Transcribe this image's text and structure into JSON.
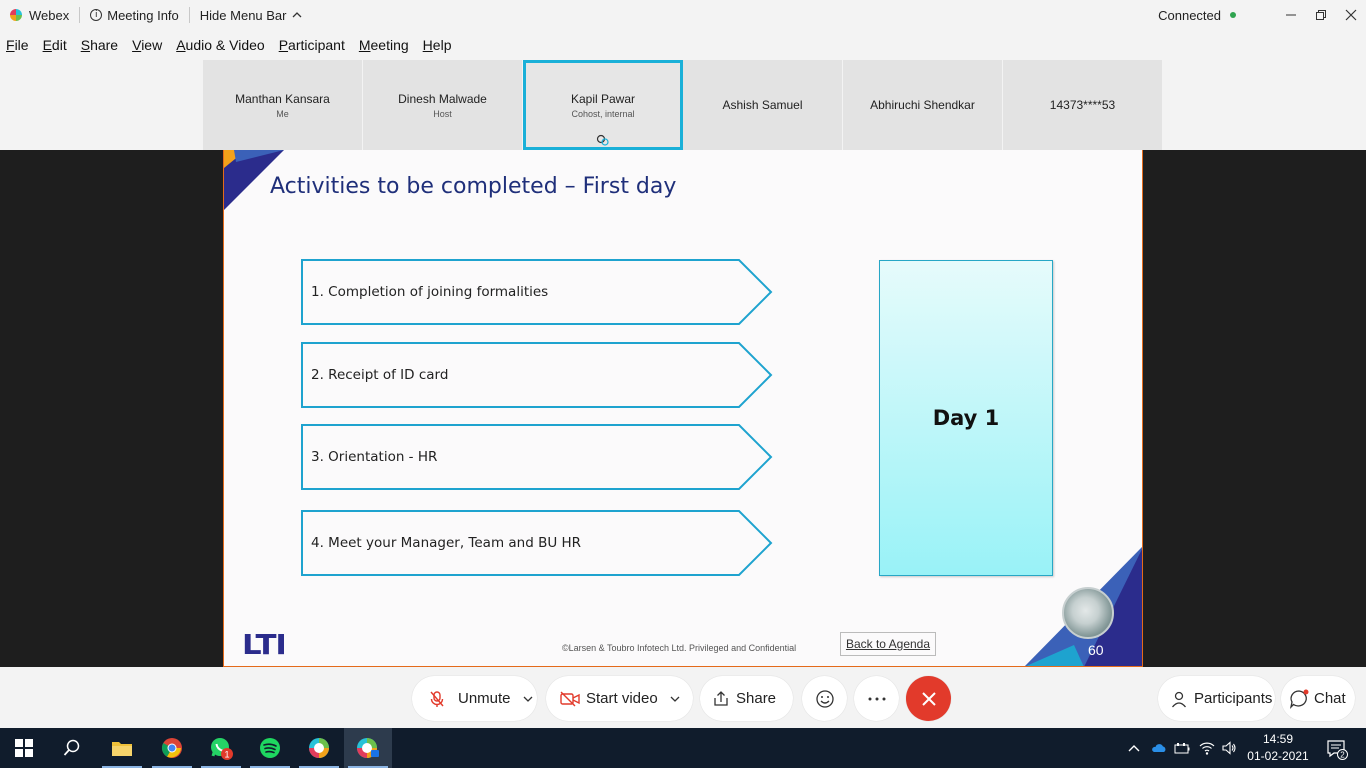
{
  "titlebar": {
    "app_name": "Webex",
    "meeting_info": "Meeting Info",
    "hide_menu_bar": "Hide Menu Bar",
    "status": "Connected"
  },
  "menu": [
    "File",
    "Edit",
    "Share",
    "View",
    "Audio & Video",
    "Participant",
    "Meeting",
    "Help"
  ],
  "participants": [
    {
      "name": "Manthan Kansara",
      "role": "Me"
    },
    {
      "name": "Dinesh Malwade",
      "role": "Host"
    },
    {
      "name": "Kapil Pawar",
      "role": "Cohost, internal"
    },
    {
      "name": "Ashish Samuel",
      "role": ""
    },
    {
      "name": "Abhiruchi Shendkar",
      "role": ""
    },
    {
      "name": "14373****53",
      "role": ""
    }
  ],
  "slide": {
    "title": "Activities to be completed – First day",
    "activities": [
      "1. Completion of joining formalities",
      "2. Receipt of ID card",
      "3. Orientation - HR",
      "4. Meet your Manager, Team and BU HR"
    ],
    "day_label": "Day 1",
    "logo_text": "LTI",
    "copyright": "©Larsen & Toubro Infotech Ltd. Privileged and Confidential",
    "back_to_agenda": "Back to Agenda",
    "page_number": "60"
  },
  "controls": {
    "unmute": "Unmute",
    "start_video": "Start video",
    "share": "Share",
    "participants": "Participants",
    "chat": "Chat",
    "end_color": "#e23a2b",
    "mute_icon_color": "#e23a2b"
  },
  "taskbar": {
    "time": "14:59",
    "date": "01-02-2021",
    "whatsapp_badge": "1",
    "notifications_count": "2"
  },
  "colors": {
    "slide_title": "#1f2f7a",
    "arrow_border": "#1ea3cf",
    "active_tile_border": "#1ab0d8"
  }
}
